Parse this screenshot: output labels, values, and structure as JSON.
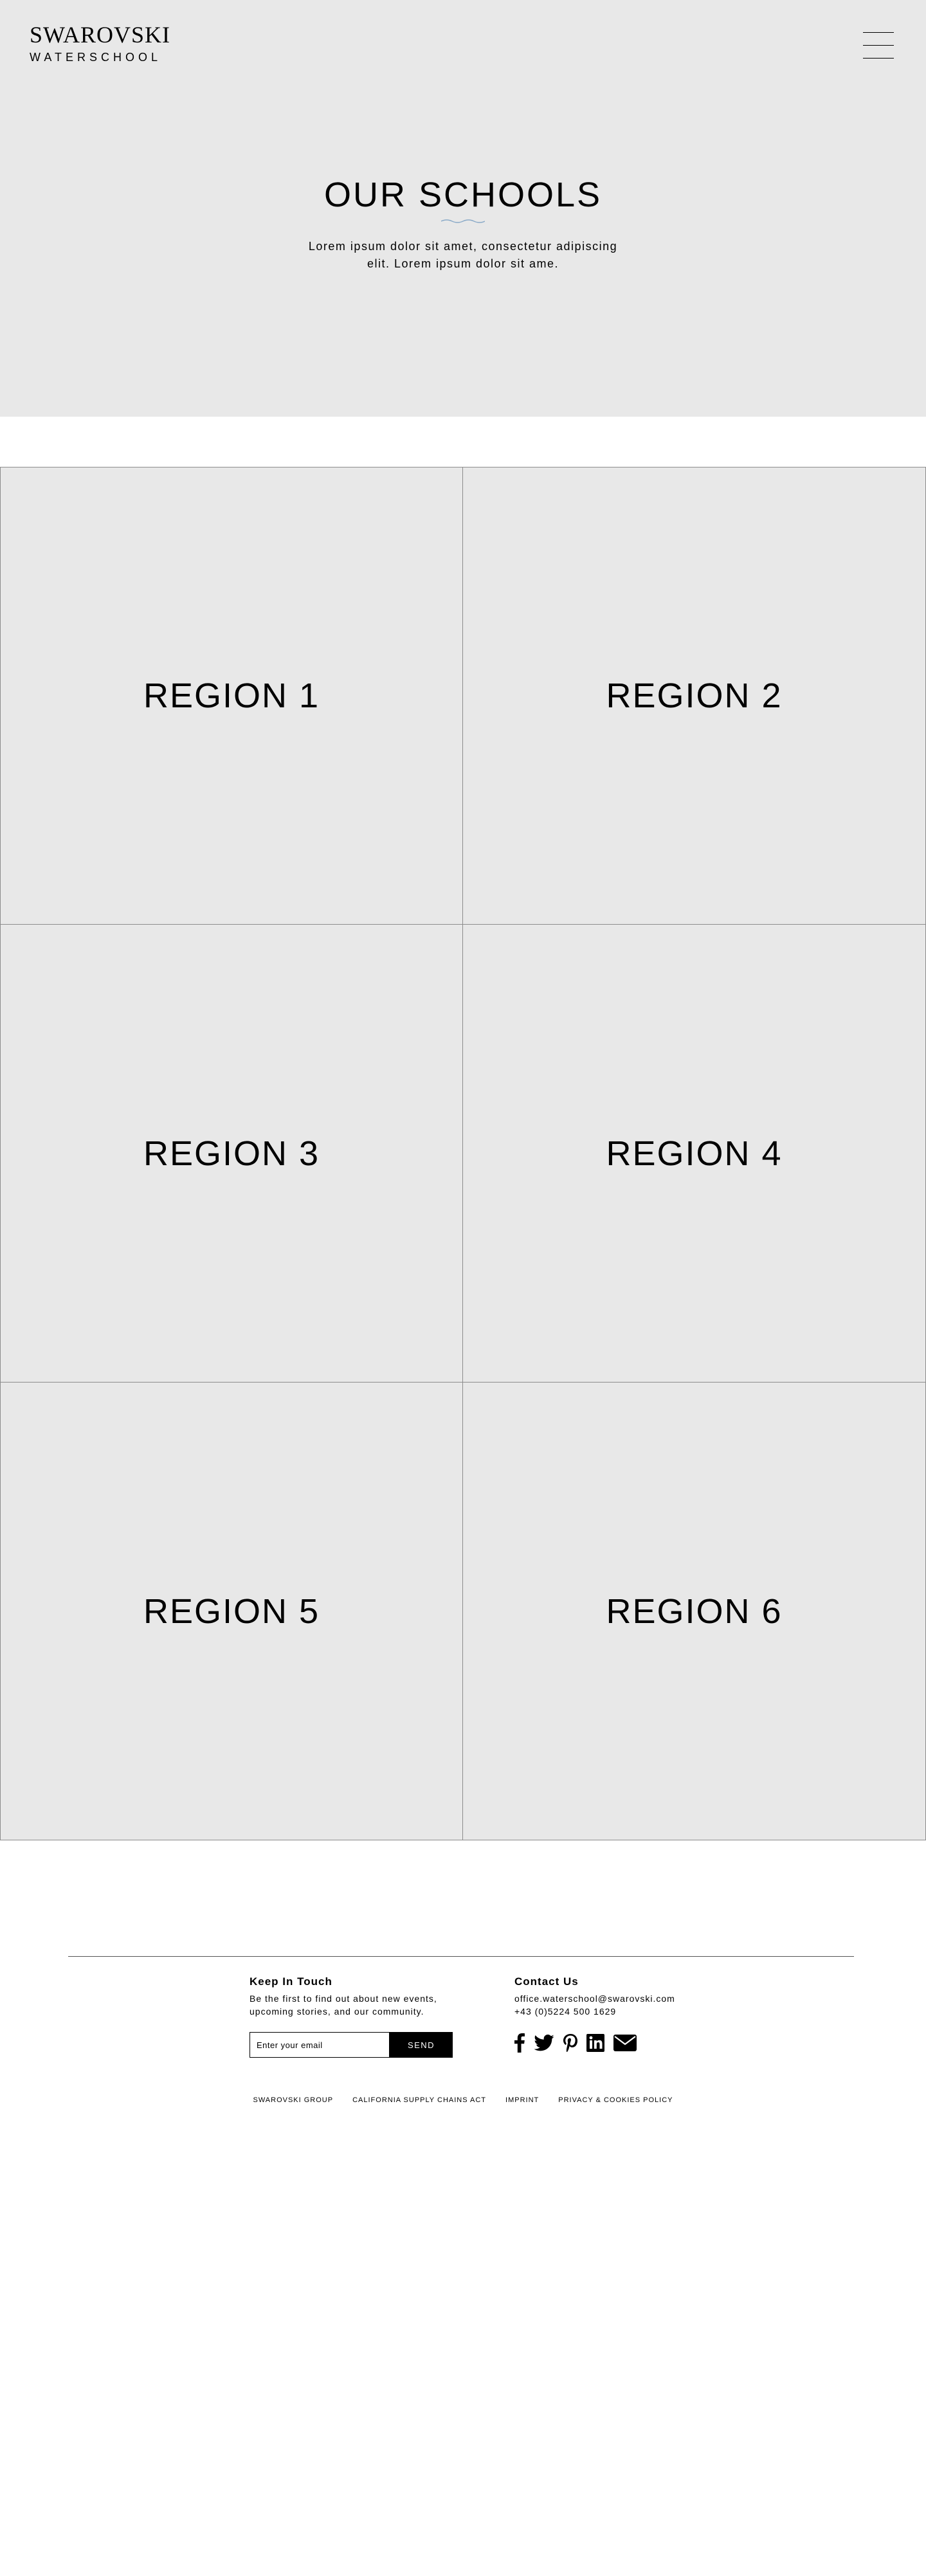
{
  "header": {
    "logo_main": "SWAROVSKI",
    "logo_sub": "WATERSCHOOL",
    "menu_icon": "hamburger-menu-icon"
  },
  "hero": {
    "title": "OUR SCHOOLS",
    "description": "Lorem ipsum dolor sit amet, consectetur adipiscing elit. Lorem ipsum dolor sit ame.",
    "background": "#e8e8e8",
    "wave_color": "#8aaac8"
  },
  "regions": [
    {
      "label": "REGION 1"
    },
    {
      "label": "REGION 2"
    },
    {
      "label": "REGION 3"
    },
    {
      "label": "REGION 4"
    },
    {
      "label": "REGION 5"
    },
    {
      "label": "REGION 6"
    }
  ],
  "footer": {
    "keep_in_touch": {
      "heading": "Keep In Touch",
      "text": "Be the first to find out about new events, upcoming stories, and our community.",
      "email_placeholder": "Enter your email",
      "send_label": "SEND"
    },
    "contact": {
      "heading": "Contact Us",
      "email": "office.waterschool@swarovski.com",
      "phone": "+43 (0)5224 500 1629"
    },
    "social_icons": [
      "facebook-icon",
      "twitter-icon",
      "pinterest-icon",
      "linkedin-icon",
      "mail-icon"
    ],
    "legal_links": [
      "SWAROVSKI GROUP",
      "CALIFORNIA SUPPLY CHAINS ACT",
      "IMPRINT",
      "PRIVACY & COOKIES POLICY"
    ]
  }
}
